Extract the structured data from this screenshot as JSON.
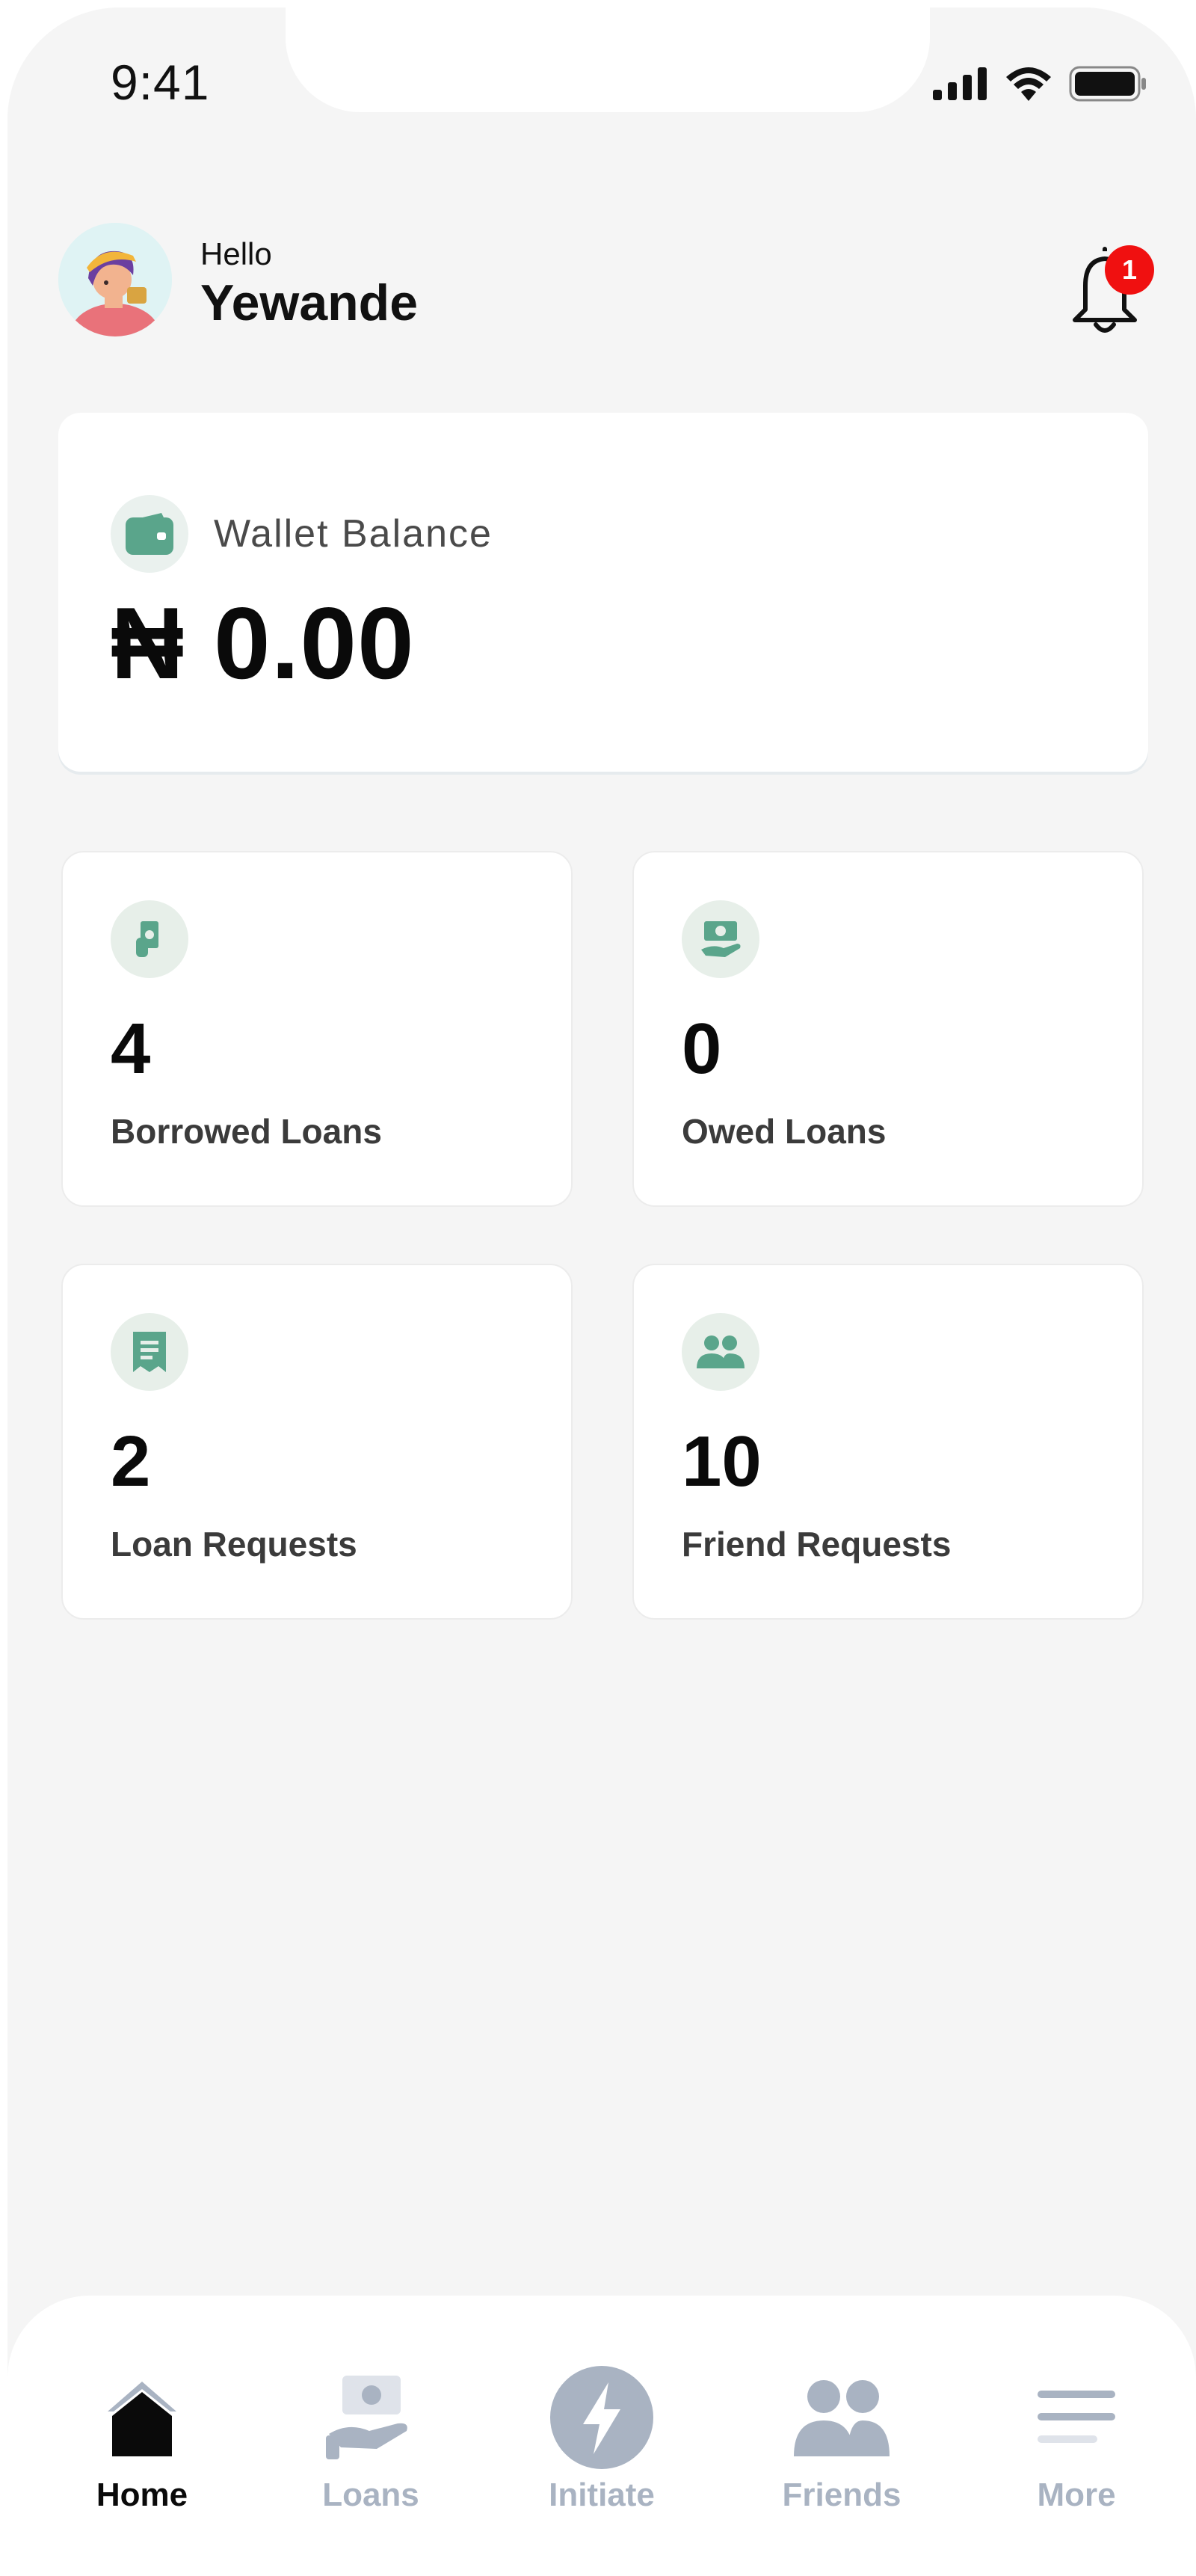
{
  "status_bar": {
    "time": "9:41"
  },
  "header": {
    "greeting": "Hello",
    "user_name": "Yewande",
    "notification_count": "1"
  },
  "wallet": {
    "label": "Wallet Balance",
    "amount": "₦ 0.00"
  },
  "stats": [
    {
      "value": "4",
      "label": "Borrowed Loans",
      "icon": "cash-hand-icon"
    },
    {
      "value": "0",
      "label": "Owed Loans",
      "icon": "money-hand-icon"
    },
    {
      "value": "2",
      "label": "Loan Requests",
      "icon": "receipt-icon"
    },
    {
      "value": "10",
      "label": "Friend Requests",
      "icon": "people-icon"
    }
  ],
  "tabbar": {
    "items": [
      {
        "label": "Home",
        "icon": "home-icon",
        "active": true
      },
      {
        "label": "Loans",
        "icon": "loans-icon",
        "active": false
      },
      {
        "label": "Initiate",
        "icon": "lightning-icon",
        "active": false
      },
      {
        "label": "Friends",
        "icon": "friends-icon",
        "active": false
      },
      {
        "label": "More",
        "icon": "menu-icon",
        "active": false
      }
    ]
  },
  "colors": {
    "background": "#f5f5f5",
    "card": "#ffffff",
    "accent_green": "#5aa58b",
    "icon_bg_green": "#e7efe9",
    "badge_red": "#f01010",
    "tab_inactive": "#a9b3c2",
    "tab_active": "#0a0a0a"
  }
}
